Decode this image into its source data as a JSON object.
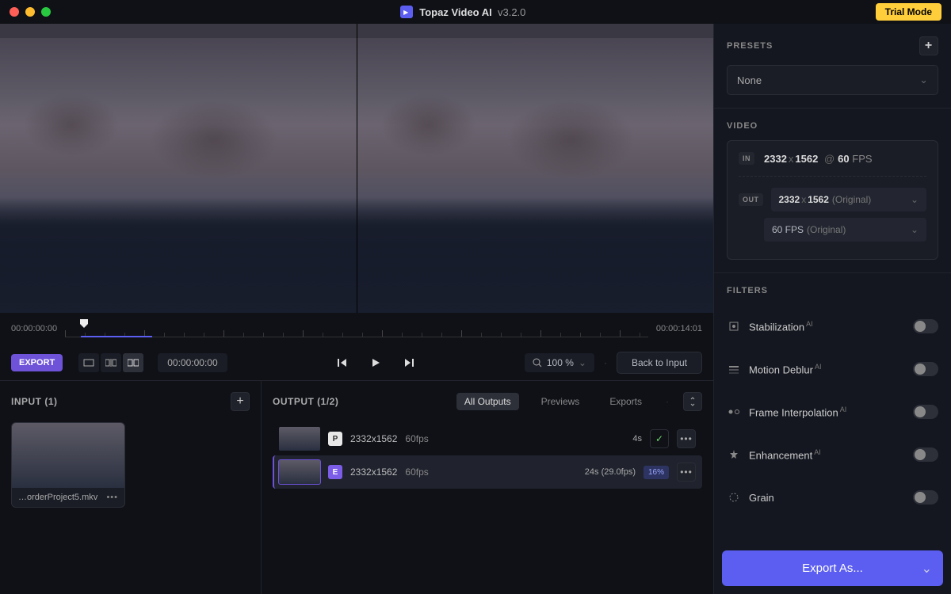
{
  "titlebar": {
    "app_name": "Topaz Video AI",
    "version": "v3.2.0",
    "trial_badge": "Trial Mode"
  },
  "timeline": {
    "start": "00:00:00:00",
    "end": "00:00:14:01",
    "current": "00:00:00:00"
  },
  "controls": {
    "export_label": "EXPORT",
    "zoom_value": "100 %",
    "back_label": "Back to Input"
  },
  "input_panel": {
    "title": "INPUT (1)",
    "file_name": "…orderProject5.mkv"
  },
  "output_panel": {
    "title": "OUTPUT (1/2)",
    "tabs": [
      "All Outputs",
      "Previews",
      "Exports"
    ],
    "active_tab": 0,
    "rows": [
      {
        "badge": "P",
        "badge_type": "p",
        "res": "2332x1562",
        "fps": "60fps",
        "time": "4s",
        "state": "done"
      },
      {
        "badge": "E",
        "badge_type": "e",
        "res": "2332x1562",
        "fps": "60fps",
        "time": "24s (29.0fps)",
        "pct": "16%",
        "state": "running"
      }
    ]
  },
  "sidebar": {
    "presets": {
      "label": "PRESETS",
      "value": "None"
    },
    "video": {
      "label": "VIDEO",
      "in_label": "IN",
      "out_label": "OUT",
      "in_w": "2332",
      "in_h": "1562",
      "in_fps": "60",
      "fps_unit": "FPS",
      "out_res": "2332x1562",
      "out_res_note": "(Original)",
      "out_fps": "60 FPS",
      "out_fps_note": "(Original)"
    },
    "filters": {
      "label": "FILTERS",
      "items": [
        {
          "name": "Stabilization",
          "ai": true,
          "icon": "stabilization-icon"
        },
        {
          "name": "Motion Deblur",
          "ai": true,
          "icon": "deblur-icon"
        },
        {
          "name": "Frame Interpolation",
          "ai": true,
          "icon": "interpolation-icon"
        },
        {
          "name": "Enhancement",
          "ai": true,
          "icon": "enhancement-icon"
        },
        {
          "name": "Grain",
          "ai": false,
          "icon": "grain-icon"
        }
      ]
    },
    "export_as": "Export As..."
  }
}
